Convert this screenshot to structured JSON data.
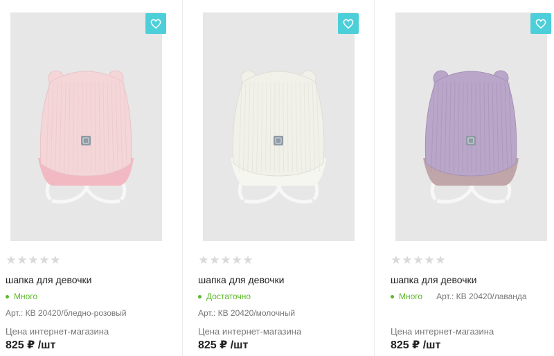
{
  "products": [
    {
      "title": "шапка для девочки",
      "stock": "Много",
      "sku": "Арт.: КВ 20420/бледно-розовый",
      "price_label": "Цена интернет-магазина",
      "price": "825 ₽ /шт",
      "rating_stars": [
        "★",
        "★",
        "★",
        "★",
        "★"
      ],
      "hat_color": "#f4d6d9",
      "hat_shade": "#e9c3c8",
      "lining_color": "#f3b9c2"
    },
    {
      "title": "шапка для девочки",
      "stock": "Достаточно",
      "sku": "Арт.: КВ 20420/молочный",
      "price_label": "Цена интернет-магазина",
      "price": "825 ₽ /шт",
      "rating_stars": [
        "★",
        "★",
        "★",
        "★",
        "★"
      ],
      "hat_color": "#f1f1ea",
      "hat_shade": "#deded6",
      "lining_color": "#f6f6f1"
    },
    {
      "title": "шапка для девочки",
      "stock": "Много",
      "sku": "Арт.: КВ 20420/лаванда",
      "price_label": "Цена интернет-магазина",
      "price": "825 ₽ /шт",
      "rating_stars": [
        "★",
        "★",
        "★",
        "★",
        "★"
      ],
      "hat_color": "#b9a6c8",
      "hat_shade": "#a590b7",
      "lining_color": "#c0a6a8"
    }
  ],
  "colors": {
    "accent": "#4ccfd9",
    "stock_green": "#5cb82a",
    "star_empty": "#d9d9d9"
  },
  "icons": {
    "favorite": "heart-icon",
    "rating": "star-icon"
  }
}
